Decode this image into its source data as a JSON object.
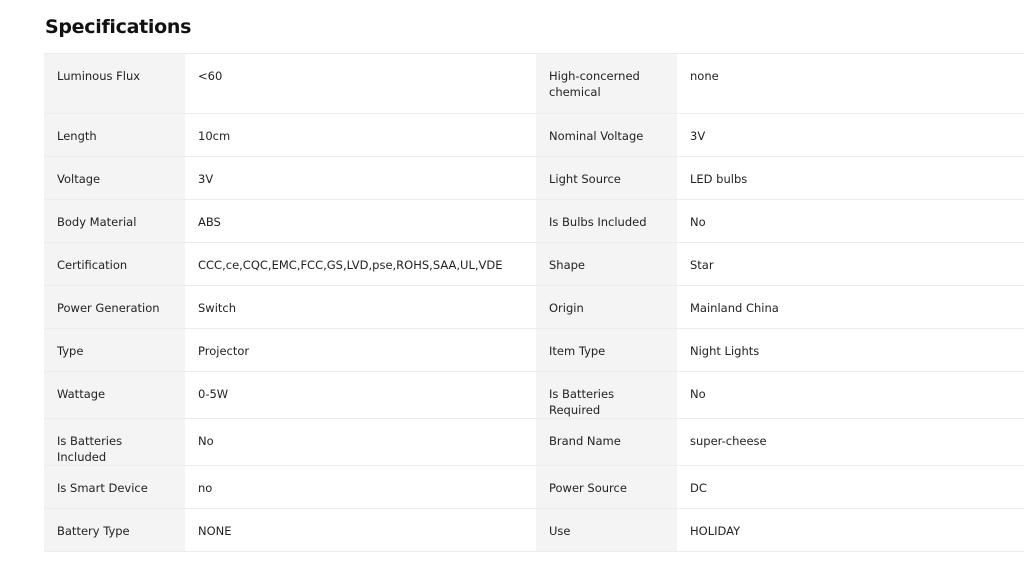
{
  "title": "Specifications",
  "rows": [
    {
      "k1": "Luminous Flux",
      "v1": "<60",
      "k2": "High-concerned chemical",
      "v2": "none"
    },
    {
      "k1": "Length",
      "v1": "10cm",
      "k2": "Nominal Voltage",
      "v2": "3V"
    },
    {
      "k1": "Voltage",
      "v1": "3V",
      "k2": "Light Source",
      "v2": "LED bulbs"
    },
    {
      "k1": "Body Material",
      "v1": "ABS",
      "k2": "Is Bulbs Included",
      "v2": "No"
    },
    {
      "k1": "Certification",
      "v1": "CCC,ce,CQC,EMC,FCC,GS,LVD,pse,ROHS,SAA,UL,VDE",
      "k2": "Shape",
      "v2": "Star"
    },
    {
      "k1": "Power Generation",
      "v1": "Switch",
      "k2": "Origin",
      "v2": "Mainland China"
    },
    {
      "k1": "Type",
      "v1": "Projector",
      "k2": "Item Type",
      "v2": "Night Lights"
    },
    {
      "k1": "Wattage",
      "v1": "0-5W",
      "k2": "Is Batteries Required",
      "v2": "No"
    },
    {
      "k1": "Is Batteries Included",
      "v1": "No",
      "k2": "Brand Name",
      "v2": "super-cheese"
    },
    {
      "k1": "Is Smart Device",
      "v1": "no",
      "k2": "Power Source",
      "v2": "DC"
    },
    {
      "k1": "Battery Type",
      "v1": "NONE",
      "k2": "Use",
      "v2": "HOLIDAY"
    }
  ]
}
